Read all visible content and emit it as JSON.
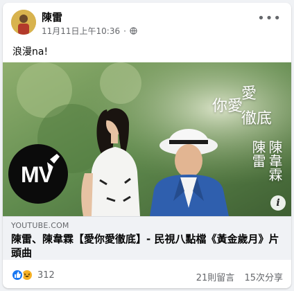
{
  "post": {
    "author": "陳雷",
    "timestamp": "11月11日上午10:36",
    "separator": "·",
    "privacy_icon": "globe-icon",
    "text": "浪漫na!"
  },
  "video": {
    "song_title_line1": "愛",
    "song_title_line2": "你愛",
    "song_title_line3": "徹底",
    "singer1": "陳雷",
    "singer2": "陳韋霖",
    "badge": "MV"
  },
  "link": {
    "domain": "YOUTUBE.COM",
    "title": "陳雷、陳韋霖【愛你愛徹底】- 民視八點檔《黃金歲月》片頭曲"
  },
  "engagement": {
    "reaction_count": "312",
    "comments": "21則留言",
    "shares": "15次分享"
  },
  "colors": {
    "accent": "#1877f2",
    "haha": "#f7b125",
    "suit": "#2f5fae"
  }
}
